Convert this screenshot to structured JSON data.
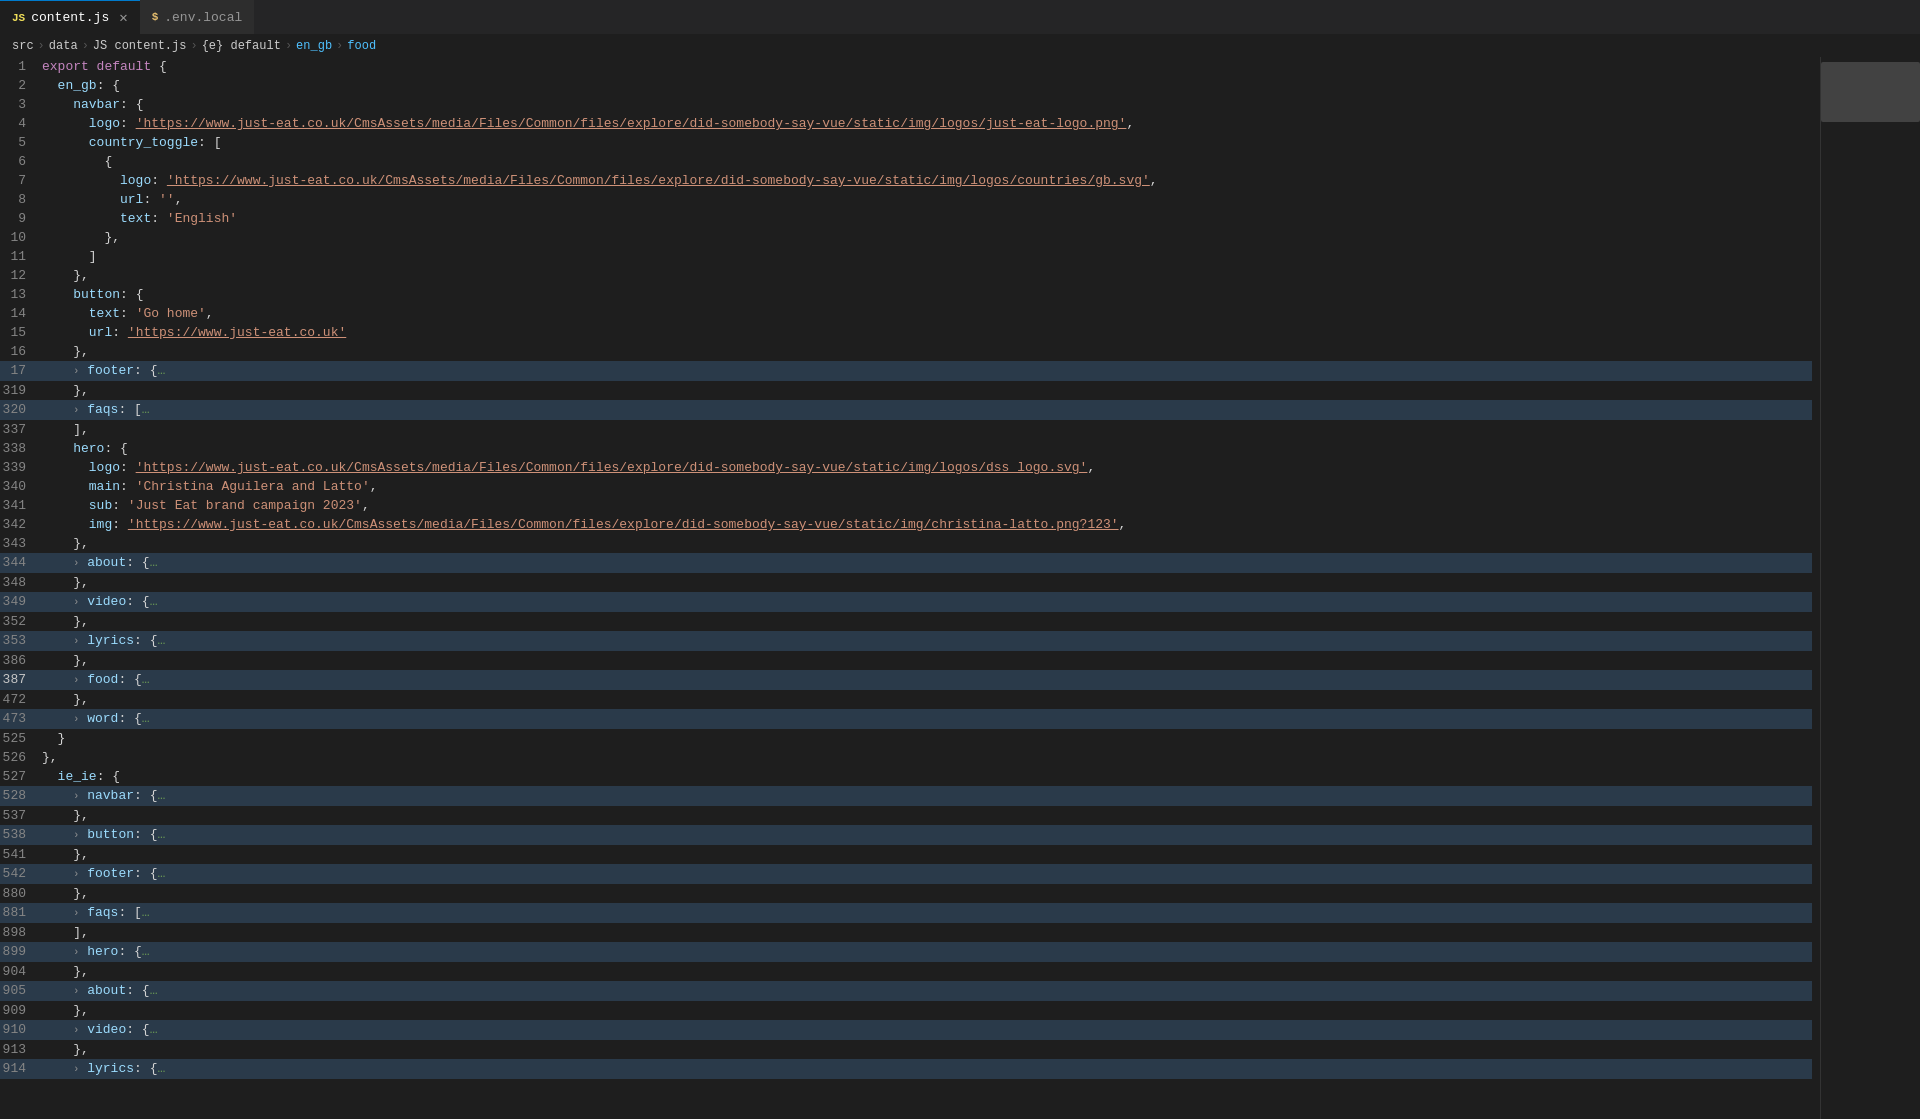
{
  "tabs": [
    {
      "id": "content-js",
      "label": "content.js",
      "icon": "js",
      "active": true
    },
    {
      "id": "env-local",
      "label": ".env.local",
      "icon": "env",
      "active": false
    }
  ],
  "breadcrumb": {
    "parts": [
      "src",
      "data",
      "JS content.js",
      "{e} default",
      "en_gb",
      "food"
    ]
  },
  "lines": [
    {
      "num": 1,
      "indent": 0,
      "tokens": [
        {
          "t": "kw2",
          "v": "export "
        },
        {
          "t": "kw2",
          "v": "default"
        },
        {
          "t": "punc",
          "v": " {"
        }
      ]
    },
    {
      "num": 2,
      "indent": 2,
      "tokens": [
        {
          "t": "prop",
          "v": "en_gb"
        },
        {
          "t": "punc",
          "v": ": {"
        }
      ]
    },
    {
      "num": 3,
      "indent": 4,
      "tokens": [
        {
          "t": "prop",
          "v": "navbar"
        },
        {
          "t": "punc",
          "v": ": {"
        }
      ]
    },
    {
      "num": 4,
      "indent": 6,
      "tokens": [
        {
          "t": "prop",
          "v": "logo"
        },
        {
          "t": "punc",
          "v": ": "
        },
        {
          "t": "str-url",
          "v": "'https://www.just-eat.co.uk/CmsAssets/media/Files/Common/files/explore/did-somebody-say-vue/static/img/logos/just-eat-logo.png'"
        },
        {
          "t": "punc",
          "v": ","
        }
      ]
    },
    {
      "num": 5,
      "indent": 6,
      "tokens": [
        {
          "t": "prop",
          "v": "country_toggle"
        },
        {
          "t": "punc",
          "v": ": ["
        }
      ]
    },
    {
      "num": 6,
      "indent": 8,
      "tokens": [
        {
          "t": "punc",
          "v": "{"
        }
      ]
    },
    {
      "num": 7,
      "indent": 10,
      "tokens": [
        {
          "t": "prop",
          "v": "logo"
        },
        {
          "t": "punc",
          "v": ": "
        },
        {
          "t": "str-url",
          "v": "'https://www.just-eat.co.uk/CmsAssets/media/Files/Common/files/explore/did-somebody-say-vue/static/img/logos/countries/gb.svg'"
        },
        {
          "t": "punc",
          "v": ","
        }
      ]
    },
    {
      "num": 8,
      "indent": 10,
      "tokens": [
        {
          "t": "prop",
          "v": "url"
        },
        {
          "t": "punc",
          "v": ": "
        },
        {
          "t": "str",
          "v": "''"
        },
        {
          "t": "punc",
          "v": ","
        }
      ]
    },
    {
      "num": 9,
      "indent": 10,
      "tokens": [
        {
          "t": "prop",
          "v": "text"
        },
        {
          "t": "punc",
          "v": ": "
        },
        {
          "t": "str",
          "v": "'English'"
        }
      ]
    },
    {
      "num": 10,
      "indent": 8,
      "tokens": [
        {
          "t": "punc",
          "v": "},"
        }
      ]
    },
    {
      "num": 11,
      "indent": 6,
      "tokens": [
        {
          "t": "punc",
          "v": "]"
        }
      ]
    },
    {
      "num": 12,
      "indent": 4,
      "tokens": [
        {
          "t": "punc",
          "v": "},"
        }
      ]
    },
    {
      "num": 13,
      "indent": 4,
      "tokens": [
        {
          "t": "prop",
          "v": "button"
        },
        {
          "t": "punc",
          "v": ": {"
        }
      ]
    },
    {
      "num": 14,
      "indent": 6,
      "tokens": [
        {
          "t": "prop",
          "v": "text"
        },
        {
          "t": "punc",
          "v": ": "
        },
        {
          "t": "str",
          "v": "'Go home'"
        },
        {
          "t": "punc",
          "v": ","
        }
      ]
    },
    {
      "num": 15,
      "indent": 6,
      "tokens": [
        {
          "t": "prop",
          "v": "url"
        },
        {
          "t": "punc",
          "v": ": "
        },
        {
          "t": "str-url",
          "v": "'https://www.just-eat.co.uk'"
        }
      ]
    },
    {
      "num": 16,
      "indent": 4,
      "tokens": [
        {
          "t": "punc",
          "v": "},"
        }
      ]
    },
    {
      "num": 17,
      "indent": 4,
      "collapsed": true,
      "tokens": [
        {
          "t": "prop",
          "v": "footer"
        },
        {
          "t": "punc",
          "v": ": {"
        },
        {
          "t": "comment",
          "v": "…"
        }
      ],
      "range_end": 319
    },
    {
      "num": 319,
      "indent": 4,
      "tokens": [
        {
          "t": "punc",
          "v": "},"
        }
      ]
    },
    {
      "num": 320,
      "indent": 4,
      "collapsed": true,
      "tokens": [
        {
          "t": "prop",
          "v": "faqs"
        },
        {
          "t": "punc",
          "v": ": ["
        },
        {
          "t": "comment",
          "v": "…"
        }
      ],
      "range_end": 337
    },
    {
      "num": 337,
      "indent": 4,
      "tokens": [
        {
          "t": "punc",
          "v": "],"
        }
      ]
    },
    {
      "num": 338,
      "indent": 4,
      "tokens": [
        {
          "t": "prop",
          "v": "hero"
        },
        {
          "t": "punc",
          "v": ": {"
        }
      ]
    },
    {
      "num": 339,
      "indent": 6,
      "tokens": [
        {
          "t": "prop",
          "v": "logo"
        },
        {
          "t": "punc",
          "v": ": "
        },
        {
          "t": "str-url",
          "v": "'https://www.just-eat.co.uk/CmsAssets/media/Files/Common/files/explore/did-somebody-say-vue/static/img/logos/dss_logo.svg'"
        },
        {
          "t": "punc",
          "v": ","
        }
      ]
    },
    {
      "num": 340,
      "indent": 6,
      "tokens": [
        {
          "t": "prop",
          "v": "main"
        },
        {
          "t": "punc",
          "v": ": "
        },
        {
          "t": "str",
          "v": "'Christina Aguilera and Latto'"
        },
        {
          "t": "punc",
          "v": ","
        }
      ]
    },
    {
      "num": 341,
      "indent": 6,
      "tokens": [
        {
          "t": "prop",
          "v": "sub"
        },
        {
          "t": "punc",
          "v": ": "
        },
        {
          "t": "str",
          "v": "'Just Eat brand campaign 2023'"
        },
        {
          "t": "punc",
          "v": ","
        }
      ]
    },
    {
      "num": 342,
      "indent": 6,
      "tokens": [
        {
          "t": "prop",
          "v": "img"
        },
        {
          "t": "punc",
          "v": ": "
        },
        {
          "t": "str-url",
          "v": "'https://www.just-eat.co.uk/CmsAssets/media/Files/Common/files/explore/did-somebody-say-vue/static/img/christina-latto.png?123'"
        },
        {
          "t": "punc",
          "v": ","
        }
      ]
    },
    {
      "num": 343,
      "indent": 4,
      "tokens": [
        {
          "t": "punc",
          "v": "},"
        }
      ]
    },
    {
      "num": 344,
      "indent": 4,
      "collapsed": true,
      "tokens": [
        {
          "t": "prop",
          "v": "about"
        },
        {
          "t": "punc",
          "v": ": {"
        },
        {
          "t": "comment",
          "v": "…"
        }
      ],
      "range_end": 348
    },
    {
      "num": 348,
      "indent": 4,
      "tokens": [
        {
          "t": "punc",
          "v": "},"
        }
      ]
    },
    {
      "num": 349,
      "indent": 4,
      "collapsed": true,
      "tokens": [
        {
          "t": "prop",
          "v": "video"
        },
        {
          "t": "punc",
          "v": ": {"
        },
        {
          "t": "comment",
          "v": "…"
        }
      ],
      "range_end": 352
    },
    {
      "num": 352,
      "indent": 4,
      "tokens": [
        {
          "t": "punc",
          "v": "},"
        }
      ]
    },
    {
      "num": 353,
      "indent": 4,
      "collapsed": true,
      "tokens": [
        {
          "t": "prop",
          "v": "lyrics"
        },
        {
          "t": "punc",
          "v": ": {"
        },
        {
          "t": "comment",
          "v": "…"
        }
      ],
      "range_end": 386
    },
    {
      "num": 386,
      "indent": 4,
      "tokens": [
        {
          "t": "punc",
          "v": "},"
        }
      ]
    },
    {
      "num": 387,
      "indent": 4,
      "selected": true,
      "collapsed": true,
      "tokens": [
        {
          "t": "prop",
          "v": "food"
        },
        {
          "t": "punc",
          "v": ": {"
        },
        {
          "t": "comment",
          "v": "…"
        }
      ],
      "range_end": 472
    },
    {
      "num": 472,
      "indent": 4,
      "tokens": [
        {
          "t": "punc",
          "v": "},"
        }
      ]
    },
    {
      "num": 473,
      "indent": 4,
      "collapsed": true,
      "tokens": [
        {
          "t": "prop",
          "v": "word"
        },
        {
          "t": "punc",
          "v": ": {"
        },
        {
          "t": "comment",
          "v": "…"
        }
      ],
      "range_end": 525
    },
    {
      "num": 525,
      "indent": 2,
      "tokens": [
        {
          "t": "punc",
          "v": "}"
        }
      ]
    },
    {
      "num": 526,
      "indent": 0,
      "tokens": [
        {
          "t": "punc",
          "v": "},"
        }
      ]
    },
    {
      "num": 527,
      "indent": 2,
      "tokens": [
        {
          "t": "prop",
          "v": "ie_ie"
        },
        {
          "t": "punc",
          "v": ": {"
        }
      ]
    },
    {
      "num": 528,
      "indent": 4,
      "collapsed": true,
      "tokens": [
        {
          "t": "prop",
          "v": "navbar"
        },
        {
          "t": "punc",
          "v": ": {"
        },
        {
          "t": "comment",
          "v": "…"
        }
      ],
      "range_end": 537
    },
    {
      "num": 537,
      "indent": 4,
      "tokens": [
        {
          "t": "punc",
          "v": "},"
        }
      ]
    },
    {
      "num": 538,
      "indent": 4,
      "collapsed": true,
      "tokens": [
        {
          "t": "prop",
          "v": "button"
        },
        {
          "t": "punc",
          "v": ": {"
        },
        {
          "t": "comment",
          "v": "…"
        }
      ],
      "range_end": 541
    },
    {
      "num": 541,
      "indent": 4,
      "tokens": [
        {
          "t": "punc",
          "v": "},"
        }
      ]
    },
    {
      "num": 542,
      "indent": 4,
      "collapsed": true,
      "tokens": [
        {
          "t": "prop",
          "v": "footer"
        },
        {
          "t": "punc",
          "v": ": {"
        },
        {
          "t": "comment",
          "v": "…"
        }
      ],
      "range_end": 880
    },
    {
      "num": 880,
      "indent": 4,
      "tokens": [
        {
          "t": "punc",
          "v": "},"
        }
      ]
    },
    {
      "num": 881,
      "indent": 4,
      "collapsed": true,
      "tokens": [
        {
          "t": "prop",
          "v": "faqs"
        },
        {
          "t": "punc",
          "v": ": ["
        },
        {
          "t": "comment",
          "v": "…"
        }
      ],
      "range_end": 898
    },
    {
      "num": 898,
      "indent": 4,
      "tokens": [
        {
          "t": "punc",
          "v": "],"
        }
      ]
    },
    {
      "num": 899,
      "indent": 4,
      "collapsed": true,
      "tokens": [
        {
          "t": "prop",
          "v": "hero"
        },
        {
          "t": "punc",
          "v": ": {"
        },
        {
          "t": "comment",
          "v": "…"
        }
      ],
      "range_end": 904
    },
    {
      "num": 904,
      "indent": 4,
      "tokens": [
        {
          "t": "punc",
          "v": "},"
        }
      ]
    },
    {
      "num": 905,
      "indent": 4,
      "collapsed": true,
      "tokens": [
        {
          "t": "prop",
          "v": "about"
        },
        {
          "t": "punc",
          "v": ": {"
        },
        {
          "t": "comment",
          "v": "…"
        }
      ],
      "range_end": 909
    },
    {
      "num": 909,
      "indent": 4,
      "tokens": [
        {
          "t": "punc",
          "v": "},"
        }
      ]
    },
    {
      "num": 910,
      "indent": 4,
      "collapsed": true,
      "tokens": [
        {
          "t": "prop",
          "v": "video"
        },
        {
          "t": "punc",
          "v": ": {"
        },
        {
          "t": "comment",
          "v": "…"
        }
      ],
      "range_end": 913
    },
    {
      "num": 913,
      "indent": 4,
      "tokens": [
        {
          "t": "punc",
          "v": "},"
        }
      ]
    },
    {
      "num": 914,
      "indent": 4,
      "collapsed": true,
      "tokens": [
        {
          "t": "prop",
          "v": "lyrics"
        },
        {
          "t": "punc",
          "v": ": {"
        },
        {
          "t": "comment",
          "v": "…"
        }
      ]
    }
  ]
}
